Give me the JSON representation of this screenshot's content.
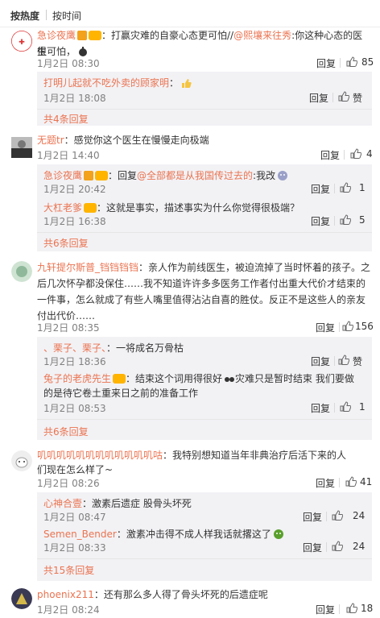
{
  "sort": {
    "hot": "按热度",
    "time": "按时间"
  },
  "reply_label": "回复",
  "comments": [
    {
      "user": "急诊夜鹰",
      "line1_a": "：打赢灾难的自豪心态更可怕//",
      "mention": "@熙壤来往秀",
      "line1_b": ":你这种心态的医生",
      "line2": "很可怕，",
      "time": "1月2日 08:30",
      "likes": "85",
      "replies": [
        {
          "user": "打明儿起就不吃外卖的顾家明",
          "text": "：",
          "time": "1月2日 18:08",
          "likes": "赞"
        }
      ],
      "more": "共4条回复"
    },
    {
      "user": "无题tr",
      "text": "：感觉你这个医生在慢慢走向极端",
      "time": "1月2日 14:40",
      "likes": "4",
      "replies": [
        {
          "user": "急诊夜鹰",
          "text_a": "：回复",
          "mention": "@全部都是从我国传过去的",
          "text_b": ":我改",
          "time": "1月2日 20:42",
          "likes": "1"
        },
        {
          "user": "大杠老爹",
          "text": "：这就是事实，描述事实为什么你觉得很极端？",
          "time": "1月2日 16:38",
          "likes": "5"
        }
      ],
      "more": "共6条回复"
    },
    {
      "user": "九轩提尔斯普_铛铛铛铛",
      "line1": "：亲人作为前线医生，被迫流掉了当时怀着的孩子。之",
      "line2": "后几次怀孕都没保住……我不知道许许多多医务工作者付出重大代价才结束的",
      "line3": "一件事，怎么就成了有些人嘴里值得沾沾自喜的胜仗。反正不是这些人的亲友",
      "line4": "付出代价……",
      "time": "1月2日 08:35",
      "likes": "156",
      "replies": [
        {
          "user": "、栗子、栗子、",
          "text": "：一将成名万骨枯",
          "time": "1月2日 18:36",
          "likes": "赞"
        },
        {
          "user": "兔子的老虎先生",
          "line1": "：结束这个词用得很好",
          "line1_b": "灾难只是暂时结束 我们要做",
          "line2": "的是待它卷土重来日之前的准备工作",
          "time": "1月2日 08:53",
          "likes": "1"
        }
      ],
      "more": "共6条回复"
    },
    {
      "user": "叽叽叽叽叽叽叽叽叽叽叽叽咕",
      "line1": "：我特别想知道当年非典治疗后活下来的人",
      "line2": "们现在怎么样了~",
      "time": "1月2日 08:26",
      "likes": "41",
      "replies": [
        {
          "user": "心神合壹",
          "text": "：激素后遗症 股骨头坏死",
          "time": "1月2日 08:47",
          "likes": "24"
        },
        {
          "user": "Semen_Bender",
          "text": "：激素冲击得不成人样我话就撂这了",
          "time": "1月2日 08:33",
          "likes": "24"
        }
      ],
      "more": "共15条回复"
    },
    {
      "user": "phoenix211",
      "text": "：还有那么多人得了骨头坏死的后遗症呢",
      "time": "1月2日 08:24",
      "likes": "18"
    }
  ]
}
